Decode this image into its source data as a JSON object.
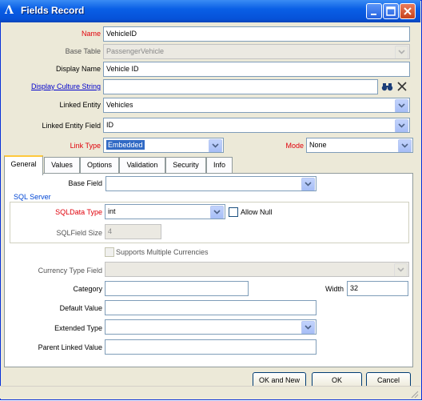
{
  "window": {
    "title": "Fields Record"
  },
  "form": {
    "name": {
      "label": "Name",
      "value": "VehicleID"
    },
    "base_table": {
      "label": "Base Table",
      "value": "PassengerVehicle"
    },
    "display_name": {
      "label": "Display Name",
      "value": "Vehicle ID"
    },
    "display_culture": {
      "label": "Display Culture String",
      "value": ""
    },
    "linked_entity": {
      "label": "Linked Entity",
      "value": "Vehicles"
    },
    "linked_entity_field": {
      "label": "Linked Entity Field",
      "value": "ID"
    },
    "link_type": {
      "label": "Link Type",
      "value": "Embedded"
    },
    "mode": {
      "label": "Mode",
      "value": "None"
    }
  },
  "tabs": [
    "General",
    "Values",
    "Options",
    "Validation",
    "Security",
    "Info"
  ],
  "general": {
    "base_field": {
      "label": "Base Field",
      "value": ""
    },
    "sql_group": "SQL Server",
    "sql_data_type": {
      "label": "SQLData Type",
      "value": "int"
    },
    "allow_null": "Allow Null",
    "sql_field_size": {
      "label": "SQLField Size",
      "value": "4"
    },
    "multi_currency": "Supports Multiple Currencies",
    "currency_type_field": {
      "label": "Currency Type Field",
      "value": ""
    },
    "category": {
      "label": "Category",
      "value": ""
    },
    "width": {
      "label": "Width",
      "value": "32"
    },
    "default_value": {
      "label": "Default Value",
      "value": ""
    },
    "extended_type": {
      "label": "Extended Type",
      "value": ""
    },
    "parent_linked_value": {
      "label": "Parent Linked Value",
      "value": ""
    }
  },
  "buttons": {
    "ok_and_new": "OK and New",
    "ok": "OK",
    "cancel": "Cancel"
  },
  "colors": {
    "title_blue": "#0a5fe6",
    "required_red": "#e0000a",
    "link_blue": "#0000cc"
  }
}
